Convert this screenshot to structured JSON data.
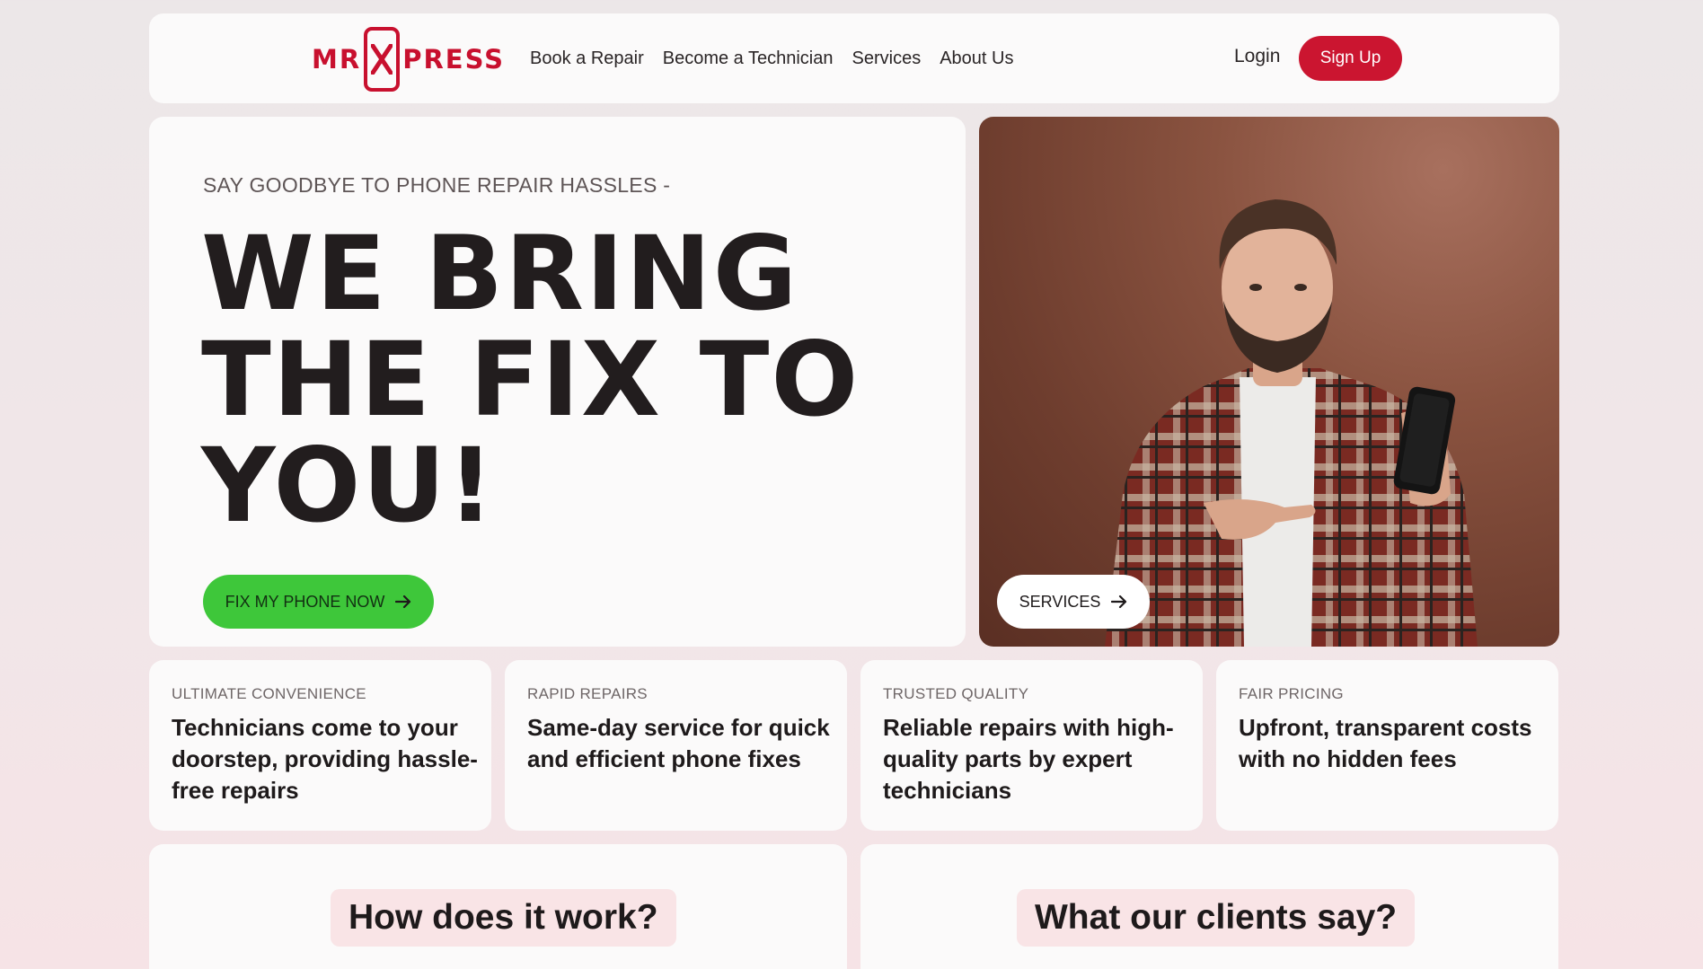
{
  "nav": {
    "logo_left": "MR",
    "logo_right": "PRESS",
    "links": [
      "Book a Repair",
      "Become a Technician",
      "Services",
      "About Us"
    ],
    "login": "Login",
    "signup": "Sign Up"
  },
  "hero": {
    "eyebrow": "SAY GOODBYE TO PHONE REPAIR HASSLES -",
    "title": "WE BRING THE FIX TO YOU!",
    "cta": "FIX MY PHONE NOW"
  },
  "photo": {
    "button": "SERVICES"
  },
  "features": [
    {
      "eyebrow": "ULTIMATE CONVENIENCE",
      "body": "Technicians come to your doorstep, providing hassle-free repairs"
    },
    {
      "eyebrow": "RAPID REPAIRS",
      "body": "Same-day service for quick and efficient phone fixes"
    },
    {
      "eyebrow": "TRUSTED QUALITY",
      "body": "Reliable repairs with high-quality parts by expert technicians"
    },
    {
      "eyebrow": "FAIR PRICING",
      "body": "Upfront, transparent costs with no hidden fees"
    }
  ],
  "sections": {
    "how": "How does it work?",
    "clients": "What our clients say?"
  },
  "colors": {
    "brand_red": "#cb1530",
    "cta_green": "#3ec73a"
  },
  "icons": {
    "arrow": "arrow-right-icon",
    "logo": "phone-x-logo-icon"
  }
}
